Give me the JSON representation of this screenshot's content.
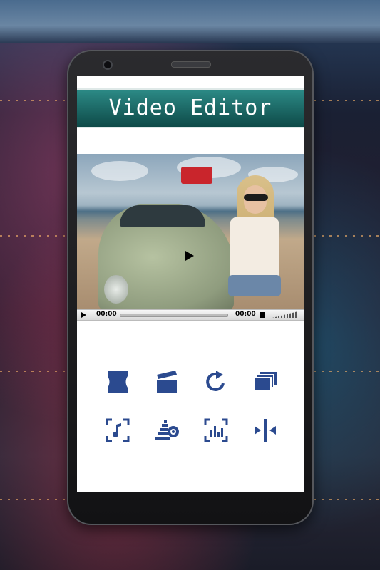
{
  "app": {
    "title": "Video Editor"
  },
  "player": {
    "current_time": "00:00",
    "duration": "00:00"
  },
  "tools_row1": [
    {
      "icon": "film-trim-icon"
    },
    {
      "icon": "clapperboard-icon"
    },
    {
      "icon": "rotate-icon"
    },
    {
      "icon": "layers-icon"
    }
  ],
  "tools_row2": [
    {
      "icon": "audio-select-icon"
    },
    {
      "icon": "speed-settings-icon"
    },
    {
      "icon": "frame-equalizer-icon"
    },
    {
      "icon": "split-icon"
    }
  ],
  "colors": {
    "header_teal": "#1f6e6b",
    "icon_blue": "#2b4a8f",
    "screen_bg": "#ffffff"
  }
}
